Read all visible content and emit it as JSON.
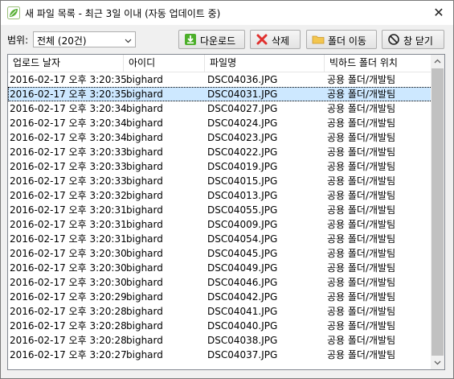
{
  "window": {
    "title": "새 파일 목록 - 최근 3일 이내 (자동 업데이트 중)",
    "close_glyph": "✕"
  },
  "toolbar": {
    "range_label": "범위:",
    "range_value": "전체 (20건)",
    "download_label": "다운로드",
    "delete_label": "삭제",
    "folder_move_label": "폴더 이동",
    "close_window_label": "창 닫기"
  },
  "table": {
    "columns": [
      "업로드 날자",
      "아이디",
      "파일명",
      "빅하드 폴더 위치"
    ],
    "selected_index": 1,
    "rows": [
      {
        "date": "2016-02-17 오후 3:20:35",
        "id": "bighard",
        "file": "DSC04036.JPG",
        "folder": "공용 폴더/개발팀"
      },
      {
        "date": "2016-02-17 오후 3:20:35",
        "id": "bighard",
        "file": "DSC04031.JPG",
        "folder": "공용 폴더/개발팀"
      },
      {
        "date": "2016-02-17 오후 3:20:34",
        "id": "bighard",
        "file": "DSC04027.JPG",
        "folder": "공용 폴더/개발팀"
      },
      {
        "date": "2016-02-17 오후 3:20:34",
        "id": "bighard",
        "file": "DSC04024.JPG",
        "folder": "공용 폴더/개발팀"
      },
      {
        "date": "2016-02-17 오후 3:20:34",
        "id": "bighard",
        "file": "DSC04023.JPG",
        "folder": "공용 폴더/개발팀"
      },
      {
        "date": "2016-02-17 오후 3:20:33",
        "id": "bighard",
        "file": "DSC04022.JPG",
        "folder": "공용 폴더/개발팀"
      },
      {
        "date": "2016-02-17 오후 3:20:33",
        "id": "bighard",
        "file": "DSC04019.JPG",
        "folder": "공용 폴더/개발팀"
      },
      {
        "date": "2016-02-17 오후 3:20:33",
        "id": "bighard",
        "file": "DSC04015.JPG",
        "folder": "공용 폴더/개발팀"
      },
      {
        "date": "2016-02-17 오후 3:20:32",
        "id": "bighard",
        "file": "DSC04013.JPG",
        "folder": "공용 폴더/개발팀"
      },
      {
        "date": "2016-02-17 오후 3:20:31",
        "id": "bighard",
        "file": "DSC04055.JPG",
        "folder": "공용 폴더/개발팀"
      },
      {
        "date": "2016-02-17 오후 3:20:31",
        "id": "bighard",
        "file": "DSC04009.JPG",
        "folder": "공용 폴더/개발팀"
      },
      {
        "date": "2016-02-17 오후 3:20:31",
        "id": "bighard",
        "file": "DSC04054.JPG",
        "folder": "공용 폴더/개발팀"
      },
      {
        "date": "2016-02-17 오후 3:20:30",
        "id": "bighard",
        "file": "DSC04045.JPG",
        "folder": "공용 폴더/개발팀"
      },
      {
        "date": "2016-02-17 오후 3:20:30",
        "id": "bighard",
        "file": "DSC04049.JPG",
        "folder": "공용 폴더/개발팀"
      },
      {
        "date": "2016-02-17 오후 3:20:30",
        "id": "bighard",
        "file": "DSC04046.JPG",
        "folder": "공용 폴더/개발팀"
      },
      {
        "date": "2016-02-17 오후 3:20:29",
        "id": "bighard",
        "file": "DSC04042.JPG",
        "folder": "공용 폴더/개발팀"
      },
      {
        "date": "2016-02-17 오후 3:20:28",
        "id": "bighard",
        "file": "DSC04041.JPG",
        "folder": "공용 폴더/개발팀"
      },
      {
        "date": "2016-02-17 오후 3:20:28",
        "id": "bighard",
        "file": "DSC04040.JPG",
        "folder": "공용 폴더/개발팀"
      },
      {
        "date": "2016-02-17 오후 3:20:28",
        "id": "bighard",
        "file": "DSC04038.JPG",
        "folder": "공용 폴더/개발팀"
      },
      {
        "date": "2016-02-17 오후 3:20:27",
        "id": "bighard",
        "file": "DSC04037.JPG",
        "folder": "공용 폴더/개발팀"
      }
    ]
  },
  "icons": {
    "app": "leaf-icon",
    "download": "download-icon",
    "delete": "delete-x-icon",
    "folder": "folder-icon",
    "close": "no-entry-icon"
  },
  "colors": {
    "selection": "#cde8ff",
    "download_green": "#4caf2a",
    "delete_red": "#e0302e",
    "folder_yellow": "#f3c64f"
  }
}
